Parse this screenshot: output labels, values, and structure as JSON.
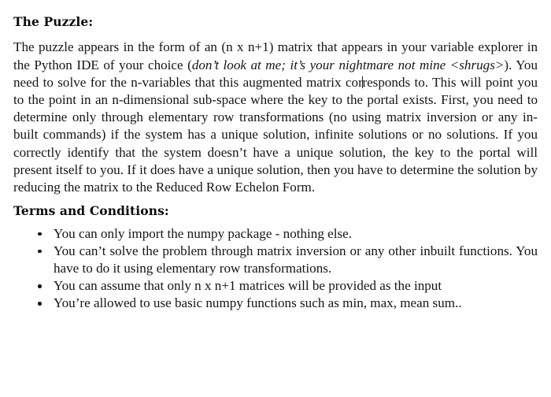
{
  "document": {
    "background_color": "#ffffff",
    "text_color": "#151515",
    "heading_color": "#0b0b0b"
  },
  "headings": {
    "puzzle": "The Puzzle:",
    "terms": "Terms and Conditions:"
  },
  "paragraph": {
    "part_1": "The puzzle appears in the form of an (n x n+1) matrix that appears in your variable explorer in the Python IDE of your choice (",
    "italic_1": "don’t look at me; it’s your nightmare not mine <shrugs>",
    "part_2": "). You need to solve for the n-variables that this augmented matrix cor",
    "part_3": "responds to. This will point you to the point in an n-dimensional sub-space where the key to the portal exists. First, you need to determine only through elementary row transformations (no using matrix inversion or any in-built commands) if the system has a unique solution, infinite solutions or no solutions. If you correctly identify that the system doesn’t have a unique solution, the key to the portal will present itself to you. If it does have a unique solution, then you have to determine the solution by reducing the matrix to the Reduced Row Echelon Form."
  },
  "terms_list": [
    "You can only import the numpy package - nothing else.",
    "You can’t solve the problem through matrix inversion or any other inbuilt functions. You have to do it using elementary row transformations.",
    "You can assume that only n x n+1 matrices will be provided as the input",
    "You’re allowed to use basic numpy functions such as min, max, mean sum.."
  ]
}
